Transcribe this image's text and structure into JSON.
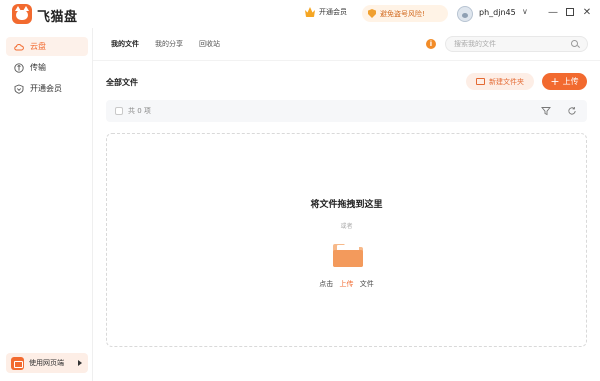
{
  "app": {
    "name": "飞猫盘"
  },
  "titlebar": {
    "vip_label": "开通会员",
    "shield_notice": "避免盗号风险!",
    "username": "ph_djn45",
    "chevron": "∨",
    "minimize": "—",
    "close": "✕"
  },
  "sidebar": {
    "items": [
      {
        "label": "云盘",
        "icon": "cloud-icon",
        "active": true
      },
      {
        "label": "传输",
        "icon": "transfer-icon",
        "active": false
      },
      {
        "label": "开通会员",
        "icon": "vip-shield-icon",
        "active": false
      }
    ],
    "web_version_label": "使用网页端"
  },
  "main": {
    "tabs": [
      {
        "label": "我的文件",
        "active": true
      },
      {
        "label": "我的分享",
        "active": false
      },
      {
        "label": "回收站",
        "active": false
      }
    ],
    "search_placeholder": "搜索我的文件",
    "section_title": "全部文件",
    "new_folder_label": "新建文件夹",
    "upload_label": "上传",
    "upload_plus": "+",
    "info_glyph": "i",
    "count_text": "共 0 项",
    "dropzone": {
      "title": "将文件拖拽到这里",
      "or": "或者",
      "click": "点击",
      "upload_link": "上传",
      "file_word": "文件"
    }
  },
  "colors": {
    "accent": "#f26a2f",
    "accent_light": "#fdeee6",
    "warning": "#f28c28"
  }
}
